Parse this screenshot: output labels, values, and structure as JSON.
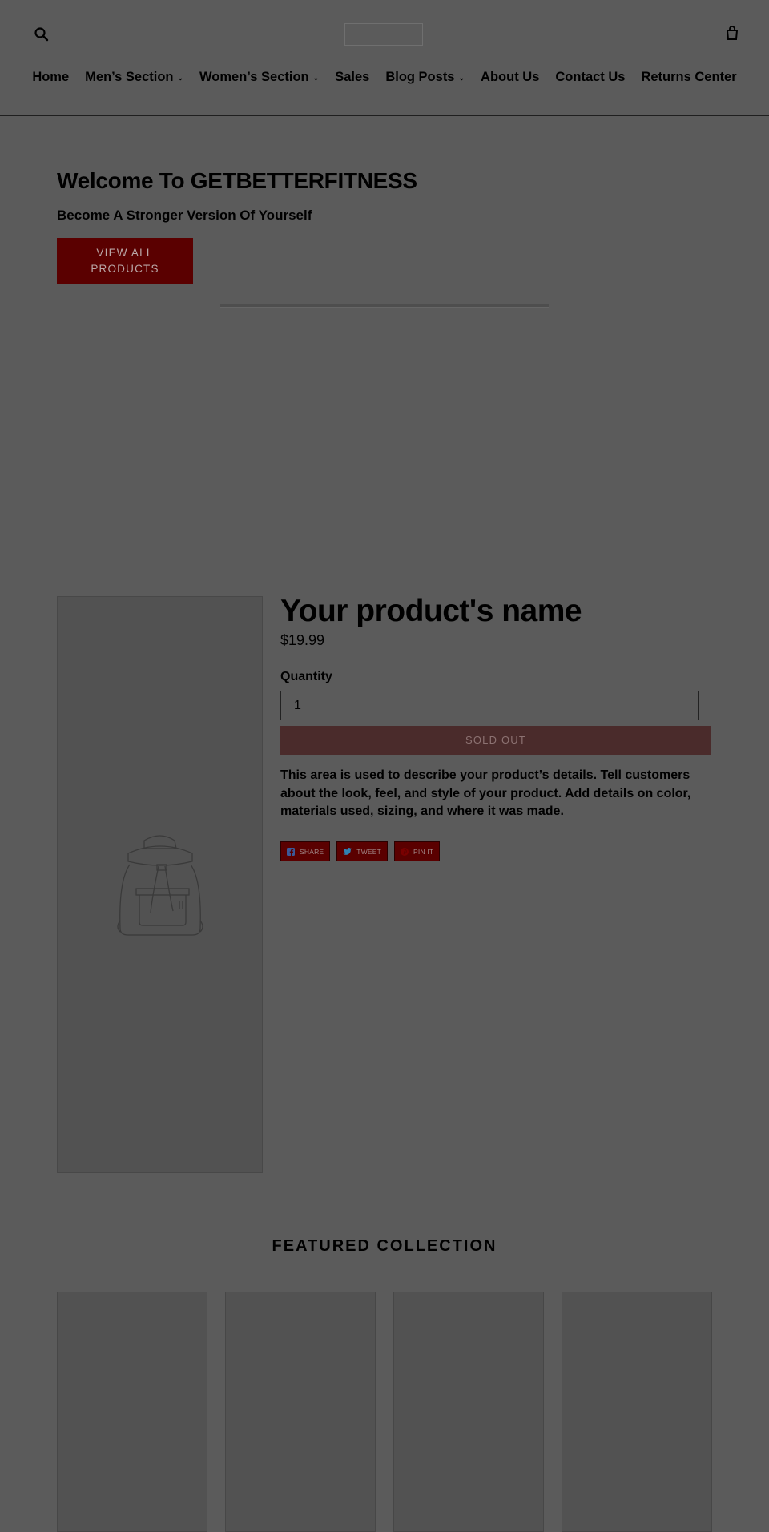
{
  "header": {
    "search_icon": "search-icon",
    "cart_icon": "cart-icon"
  },
  "nav": {
    "items": [
      {
        "label": "Home",
        "dropdown": false
      },
      {
        "label": "Men’s Section",
        "dropdown": true
      },
      {
        "label": "Women’s Section",
        "dropdown": true
      },
      {
        "label": "Sales",
        "dropdown": false
      },
      {
        "label": "Blog Posts",
        "dropdown": true
      },
      {
        "label": "About Us",
        "dropdown": false
      },
      {
        "label": "Contact Us",
        "dropdown": false
      },
      {
        "label": "Returns Center",
        "dropdown": false
      }
    ],
    "chevron": "⌄"
  },
  "hero": {
    "title": "Welcome To GETBETTERFITNESS",
    "subtitle": "Become A Stronger Version Of Yourself",
    "button_line1": "VIEW ALL",
    "button_line2": "PRODUCTS"
  },
  "product": {
    "name": "Your product's name",
    "price": "$19.99",
    "quantity_label": "Quantity",
    "quantity_value": "1",
    "sold_out_label": "SOLD OUT",
    "description": "This area is used to describe your product’s details. Tell customers about the look, feel, and style of your product. Add details on color, materials used, sizing, and where it was made.",
    "image_icon": "backpack-icon"
  },
  "share": {
    "facebook": "SHARE",
    "twitter": "TWEET",
    "pinterest": "PIN IT"
  },
  "featured": {
    "title": "FEATURED COLLECTION",
    "card_count": 4
  },
  "colors": {
    "background": "#5b5b5b",
    "accent": "#5a0000",
    "sold_out": "#4a2b2b"
  }
}
